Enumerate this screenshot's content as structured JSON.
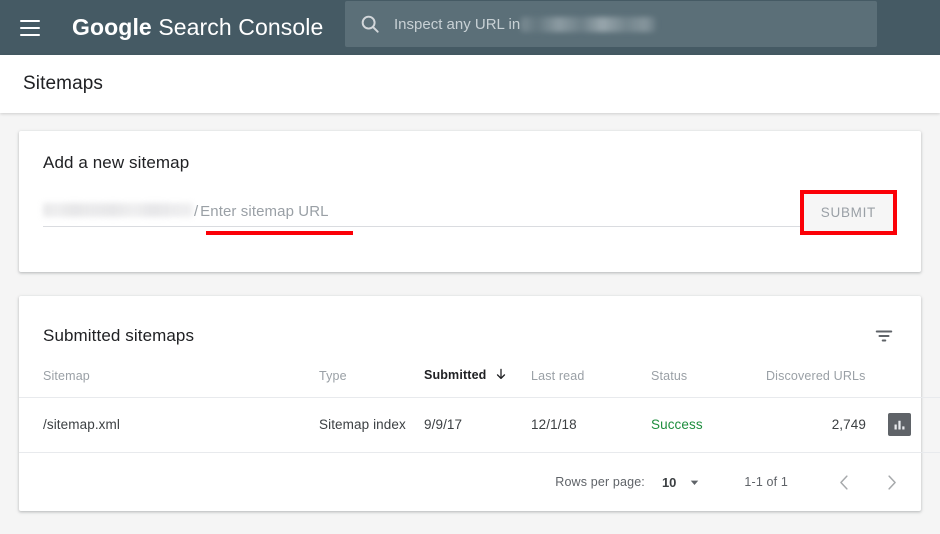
{
  "header": {
    "menu_icon": "hamburger-menu-icon",
    "brand_bold": "Google",
    "brand_light": " Search Console",
    "search": {
      "icon": "search-icon",
      "placeholder_visible": "Inspect any URL in",
      "value": ""
    }
  },
  "page": {
    "title": "Sitemaps"
  },
  "add_sitemap": {
    "heading": "Add a new sitemap",
    "domain_prefix_redacted": "",
    "path_separator": "/",
    "input_placeholder": "Enter sitemap URL",
    "input_value": "",
    "submit_label": "SUBMIT",
    "annotation_color": "#fb0007"
  },
  "submitted_sitemaps": {
    "heading": "Submitted sitemaps",
    "filter_icon": "filter-icon",
    "columns": [
      {
        "key": "sitemap",
        "label": "Sitemap",
        "sorted": false
      },
      {
        "key": "type",
        "label": "Type",
        "sorted": false
      },
      {
        "key": "submitted",
        "label": "Submitted",
        "sorted": true,
        "sort_direction": "desc"
      },
      {
        "key": "last_read",
        "label": "Last read",
        "sorted": false
      },
      {
        "key": "status",
        "label": "Status",
        "sorted": false
      },
      {
        "key": "discovered_urls",
        "label": "Discovered URLs",
        "sorted": false
      }
    ],
    "rows": [
      {
        "sitemap": "/sitemap.xml",
        "type": "Sitemap index",
        "submitted": "9/9/17",
        "last_read": "12/1/18",
        "status": "Success",
        "status_color": "#1e8e3e",
        "discovered_urls": "2,749",
        "action_icon": "bar-chart-icon"
      }
    ],
    "footer": {
      "rows_per_page_label": "Rows per page:",
      "rows_per_page_value": "10",
      "range_label": "1-1 of 1",
      "prev_icon": "chevron-left-icon",
      "next_icon": "chevron-right-icon"
    }
  }
}
